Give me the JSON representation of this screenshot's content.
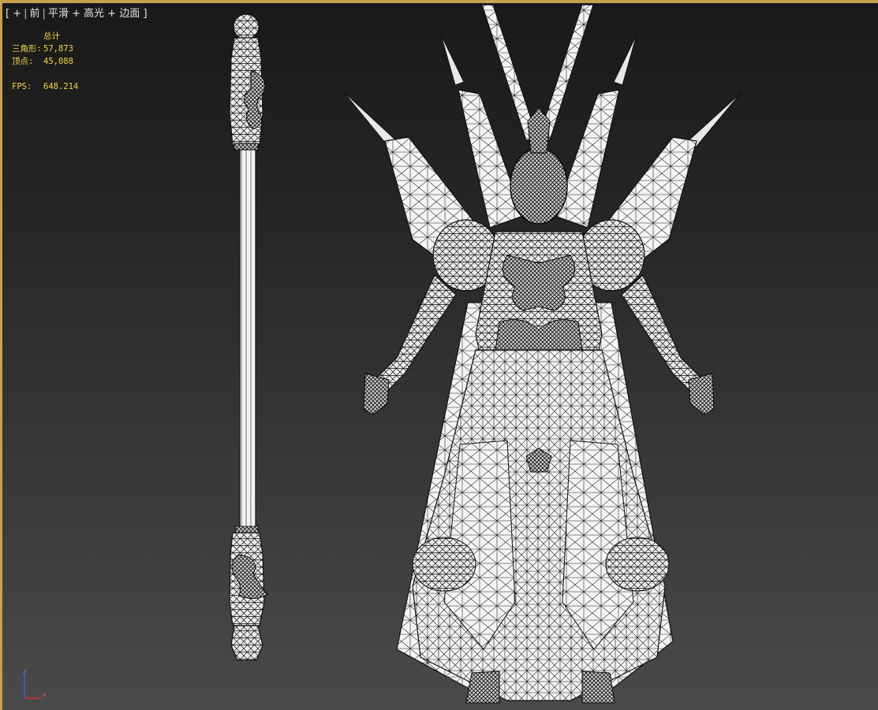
{
  "viewport": {
    "label": {
      "bracket_open": "[",
      "plus": "+",
      "view": "前",
      "shading": "平滑",
      "highlight": "高光",
      "edged_faces": "边面",
      "bracket_close": "]"
    },
    "stats": {
      "header": "总计",
      "triangles_label": "三角形:",
      "triangles_value": "57,873",
      "vertices_label": "顶点:",
      "vertices_value": "45,088",
      "fps_label": "FPS:",
      "fps_value": "648.214"
    },
    "axis": {
      "z": "z",
      "x": "x"
    },
    "colors": {
      "frame": "#c8a050",
      "stats_text": "#f2d64a",
      "axis_z": "#3a5cff",
      "axis_x": "#d03030",
      "mesh_fill": "#f2f2f2",
      "mesh_wire": "#101010"
    }
  },
  "scene": {
    "objects": [
      "staff-model",
      "armored-figure-model"
    ]
  }
}
